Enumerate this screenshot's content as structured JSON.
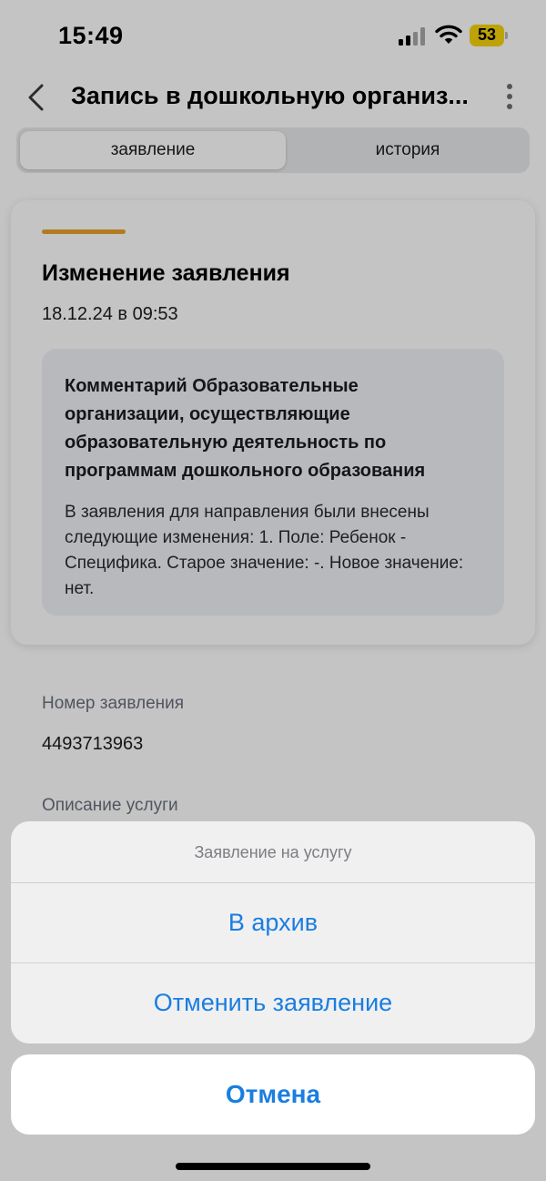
{
  "status_bar": {
    "time": "15:49",
    "battery_percent": "53",
    "battery_color": "#f6d40a"
  },
  "nav": {
    "title": "Запись в дошкольную организ...",
    "back_icon": "chevron-left-icon",
    "more_icon": "more-vertical-icon"
  },
  "tabs": [
    {
      "label": "заявление",
      "active": true
    },
    {
      "label": "история",
      "active": false
    }
  ],
  "event_card": {
    "accent_color": "#e8a22b",
    "title": "Изменение заявления",
    "date": "18.12.24 в 09:53",
    "comment_title": "Комментарий Образовательные организации, осуществляющие образовательную деятельность по программам дошкольного образования",
    "comment_text": "В заявления для направления были внесены следующие изменения: 1. Поле: Ребенок - Специфика. Старое значение: -. Новое значение: нет."
  },
  "fields": [
    {
      "label": "Номер заявления",
      "value": "4493713963"
    },
    {
      "label": "Описание услуги"
    }
  ],
  "action_sheet": {
    "title": "Заявление на услугу",
    "actions": [
      {
        "label": "В архив"
      },
      {
        "label": "Отменить заявление"
      }
    ],
    "cancel_label": "Отмена",
    "action_color": "#1a7ee0"
  }
}
